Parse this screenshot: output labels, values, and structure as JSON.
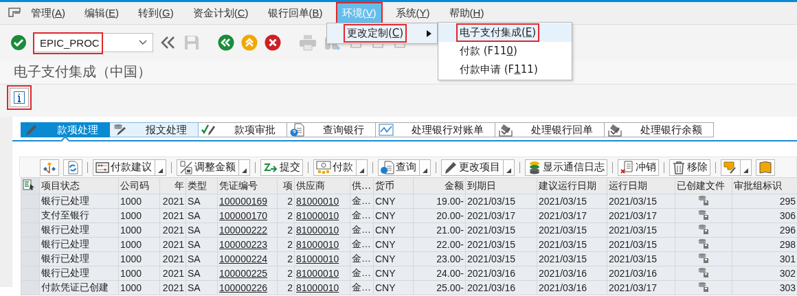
{
  "menu_bar": {
    "items": [
      {
        "before": "管理(",
        "key": "A",
        "after": ")",
        "selected": false,
        "highlighted": false
      },
      {
        "before": "编辑(",
        "key": "E",
        "after": ")",
        "selected": false,
        "highlighted": false
      },
      {
        "before": "转到(",
        "key": "G",
        "after": ")",
        "selected": false,
        "highlighted": false
      },
      {
        "before": "资金计划(",
        "key": "C",
        "after": ")",
        "selected": false,
        "highlighted": false
      },
      {
        "before": "银行回单(",
        "key": "B",
        "after": ")",
        "selected": false,
        "highlighted": false
      },
      {
        "before": "环境(",
        "key": "V",
        "after": ")",
        "selected": true,
        "highlighted": true
      },
      {
        "before": "系统(",
        "key": "Y",
        "after": ")",
        "selected": false,
        "highlighted": false
      },
      {
        "before": "帮助(",
        "key": "H",
        "after": ")",
        "selected": false,
        "highlighted": false
      }
    ]
  },
  "dropdown": {
    "items": [
      {
        "before": "更改定制(",
        "key": "C",
        "after": ")",
        "highlighted": true,
        "submenu": true
      }
    ]
  },
  "submenu": {
    "items": [
      {
        "before": "电子支付集成(",
        "key": "E",
        "after": ")",
        "selected": true,
        "highlighted": true
      },
      {
        "before": "付款 (F11",
        "key": "0",
        "after": ")",
        "selected": false,
        "highlighted": false
      },
      {
        "before": "付款申请 (F",
        "key": "1",
        "after": "11)",
        "selected": false,
        "highlighted": false
      }
    ]
  },
  "toolbar": {
    "command_field": {
      "value": "EPIC_PROC",
      "highlighted": true
    }
  },
  "title": "电子支付集成（中国）",
  "info_button": {
    "highlighted": true
  },
  "tabs": [
    {
      "label": "款项处理",
      "selected": true,
      "hovered": false
    },
    {
      "label": "报文处理",
      "selected": false,
      "hovered": true
    },
    {
      "label": "款项审批",
      "selected": false,
      "hovered": false
    },
    {
      "label": "查询银行",
      "selected": false,
      "hovered": false
    },
    {
      "label": "处理银行对账单",
      "selected": false,
      "hovered": false
    },
    {
      "label": "处理银行回单",
      "selected": false,
      "hovered": false
    },
    {
      "label": "处理银行余额",
      "selected": false,
      "hovered": false
    }
  ],
  "alv_toolbar": {
    "groups": [
      [
        {
          "menu": false
        },
        {
          "menu": false
        }
      ],
      [
        {
          "label": "付款建议",
          "menu": true
        }
      ],
      [
        {
          "label": "调整金额",
          "menu": true
        }
      ],
      [
        {
          "label": "提交",
          "menu": false
        }
      ],
      [
        {
          "label": "付款",
          "menu": true
        }
      ],
      [
        {
          "label": "查询",
          "menu": true
        }
      ],
      [
        {
          "label": "更改项目",
          "menu": true
        }
      ],
      [
        {
          "label": "显示通信日志",
          "menu": false
        }
      ],
      [
        {
          "label": "冲销",
          "menu": false
        }
      ],
      [
        {
          "label": "移除",
          "menu": false
        }
      ],
      [
        {
          "menu": true
        },
        {
          "menu": false
        }
      ]
    ]
  },
  "table": {
    "columns": [
      {
        "label": "项目状态",
        "kind": "text"
      },
      {
        "label": "公司码",
        "kind": "text"
      },
      {
        "label": "年",
        "kind": "number"
      },
      {
        "label": "类型",
        "kind": "text"
      },
      {
        "label": "凭证编号",
        "kind": "link"
      },
      {
        "label": "项",
        "kind": "number"
      },
      {
        "label": "供应商",
        "kind": "link"
      },
      {
        "label": "供…",
        "kind": "text"
      },
      {
        "label": "货币",
        "kind": "text"
      },
      {
        "label": "金额",
        "kind": "number"
      },
      {
        "label": "到期日",
        "kind": "text"
      },
      {
        "label": "建议运行日期",
        "kind": "text"
      },
      {
        "label": "运行日期",
        "kind": "text"
      },
      {
        "label": "已创建文件",
        "kind": "icon"
      },
      {
        "label": "审批组标识",
        "kind": "number"
      }
    ],
    "rows": [
      {
        "cells": [
          "银行已处理",
          "1000",
          "2021",
          "SA",
          "100000169",
          "2",
          "81000010",
          "金…",
          "CNY",
          "19.00-",
          "2021/03/15",
          "2021/03/15",
          "2021/03/15",
          "295"
        ],
        "file_created": true
      },
      {
        "cells": [
          "支付至银行",
          "1000",
          "2021",
          "SA",
          "100000170",
          "2",
          "81000010",
          "金…",
          "CNY",
          "20.00-",
          "2021/03/17",
          "2021/03/17",
          "2021/03/17",
          "306"
        ],
        "file_created": true
      },
      {
        "cells": [
          "银行已处理",
          "1000",
          "2021",
          "SA",
          "100000222",
          "2",
          "81000010",
          "金…",
          "CNY",
          "21.00-",
          "2021/03/15",
          "2021/03/15",
          "2021/03/15",
          "296"
        ],
        "file_created": true
      },
      {
        "cells": [
          "银行已处理",
          "1000",
          "2021",
          "SA",
          "100000223",
          "2",
          "81000010",
          "金…",
          "CNY",
          "22.00-",
          "2021/03/15",
          "2021/03/15",
          "2021/03/15",
          "298"
        ],
        "file_created": true
      },
      {
        "cells": [
          "银行已处理",
          "1000",
          "2021",
          "SA",
          "100000224",
          "2",
          "81000010",
          "金…",
          "CNY",
          "23.00-",
          "2021/03/15",
          "2021/03/15",
          "2021/03/15",
          "301"
        ],
        "file_created": true
      },
      {
        "cells": [
          "银行已处理",
          "1000",
          "2021",
          "SA",
          "100000225",
          "2",
          "81000010",
          "金…",
          "CNY",
          "24.00-",
          "2021/03/16",
          "2021/03/16",
          "2021/03/16",
          "302"
        ],
        "file_created": true
      },
      {
        "cells": [
          "付款凭证已创建",
          "1000",
          "2021",
          "SA",
          "100000226",
          "2",
          "81000010",
          "金…",
          "CNY",
          "25.00-",
          "2021/03/16",
          "2021/03/16",
          "2021/03/17",
          "303"
        ],
        "file_created": true
      }
    ]
  }
}
